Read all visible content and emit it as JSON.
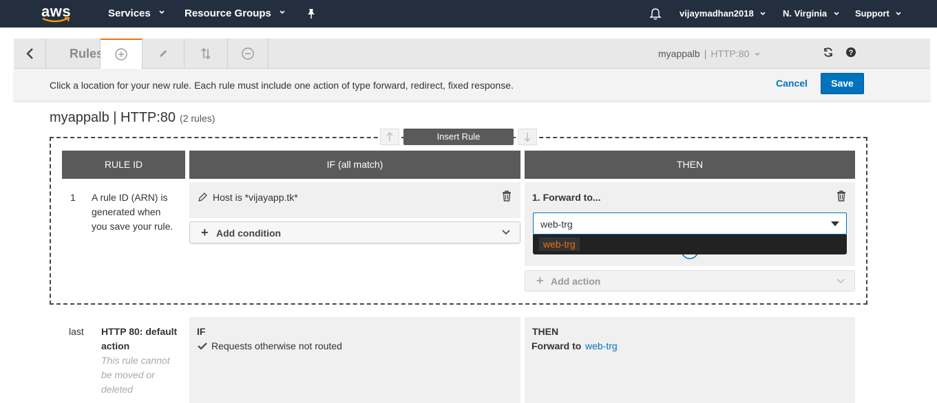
{
  "topnav": {
    "logo_text": "aws",
    "services": "Services",
    "resource_groups": "Resource Groups",
    "user": "vijaymadhan2018",
    "region": "N. Virginia",
    "support": "Support"
  },
  "toolbar": {
    "title": "Rules",
    "lb_name": "myappalb",
    "listener": "HTTP:80"
  },
  "infobar": {
    "message": "Click a location for your new rule. Each rule must include one action of type forward, redirect, fixed response.",
    "cancel_label": "Cancel",
    "save_label": "Save"
  },
  "heading": {
    "title": "myappalb | HTTP:80",
    "count": "(2 rules)"
  },
  "insert_rule_label": "Insert Rule",
  "columns": {
    "rule_id": "RULE ID",
    "if": "IF (all match)",
    "then": "THEN"
  },
  "rule1": {
    "number": "1",
    "id_text": [
      "A rule ID (ARN) is",
      "generated when",
      "you save your rule."
    ],
    "condition": "Host is *vijayapp.tk*",
    "add_condition": "Add condition",
    "action_title": "1. Forward to...",
    "target_value": "web-trg",
    "dropdown_option": "web-trg",
    "add_action": "Add action"
  },
  "default_rule": {
    "number": "last",
    "name_line1": "HTTP 80: default",
    "name_line2": "action",
    "note": [
      "This rule cannot",
      "be moved or",
      "deleted"
    ],
    "if_label": "IF",
    "if_text": "Requests otherwise not routed",
    "then_label": "THEN",
    "forward_label": "Forward to",
    "forward_target": "web-trg"
  },
  "colors": {
    "nav_bg": "#232f3e",
    "accent": "#ec7211",
    "primary": "#0073bb",
    "header_gray": "#5a5a5a"
  }
}
